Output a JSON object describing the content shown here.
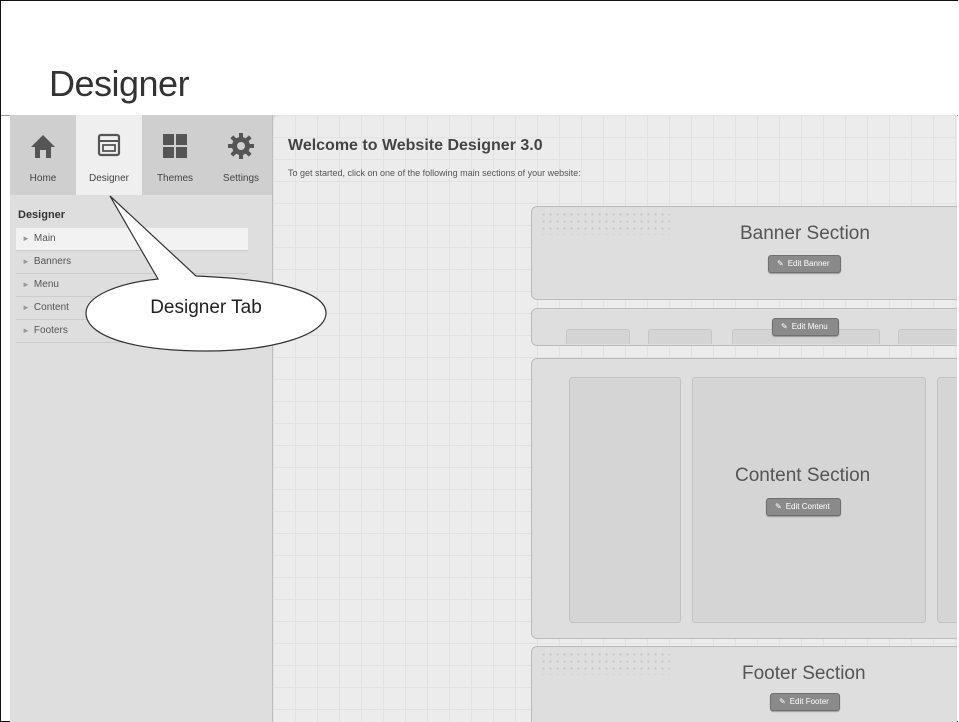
{
  "slide": {
    "title": "Designer"
  },
  "toolbar": {
    "tabs": [
      {
        "label": "Home",
        "icon": "home-icon"
      },
      {
        "label": "Designer",
        "icon": "designer-icon",
        "active": true
      },
      {
        "label": "Themes",
        "icon": "themes-icon"
      },
      {
        "label": "Settings",
        "icon": "gear-icon"
      }
    ]
  },
  "sidebar": {
    "heading": "Designer",
    "items": [
      {
        "label": "Main",
        "active": true
      },
      {
        "label": "Banners"
      },
      {
        "label": "Menu"
      },
      {
        "label": "Content"
      },
      {
        "label": "Footers"
      }
    ]
  },
  "main": {
    "welcome": "Welcome to Website Designer 3.0",
    "subtitle": "To get started, click on one of the following main sections of your website:",
    "banner": {
      "title": "Banner Section",
      "button": "Edit Banner"
    },
    "menu": {
      "button": "Edit Menu"
    },
    "content": {
      "title": "Content Section",
      "button": "Edit Content"
    },
    "footer": {
      "title": "Footer Section",
      "button": "Edit Footer"
    }
  },
  "callout": {
    "text": "Designer Tab"
  },
  "colors": {
    "active_tab": "#efefef",
    "button": "#8a8a8a",
    "canvas": "#ececec"
  }
}
